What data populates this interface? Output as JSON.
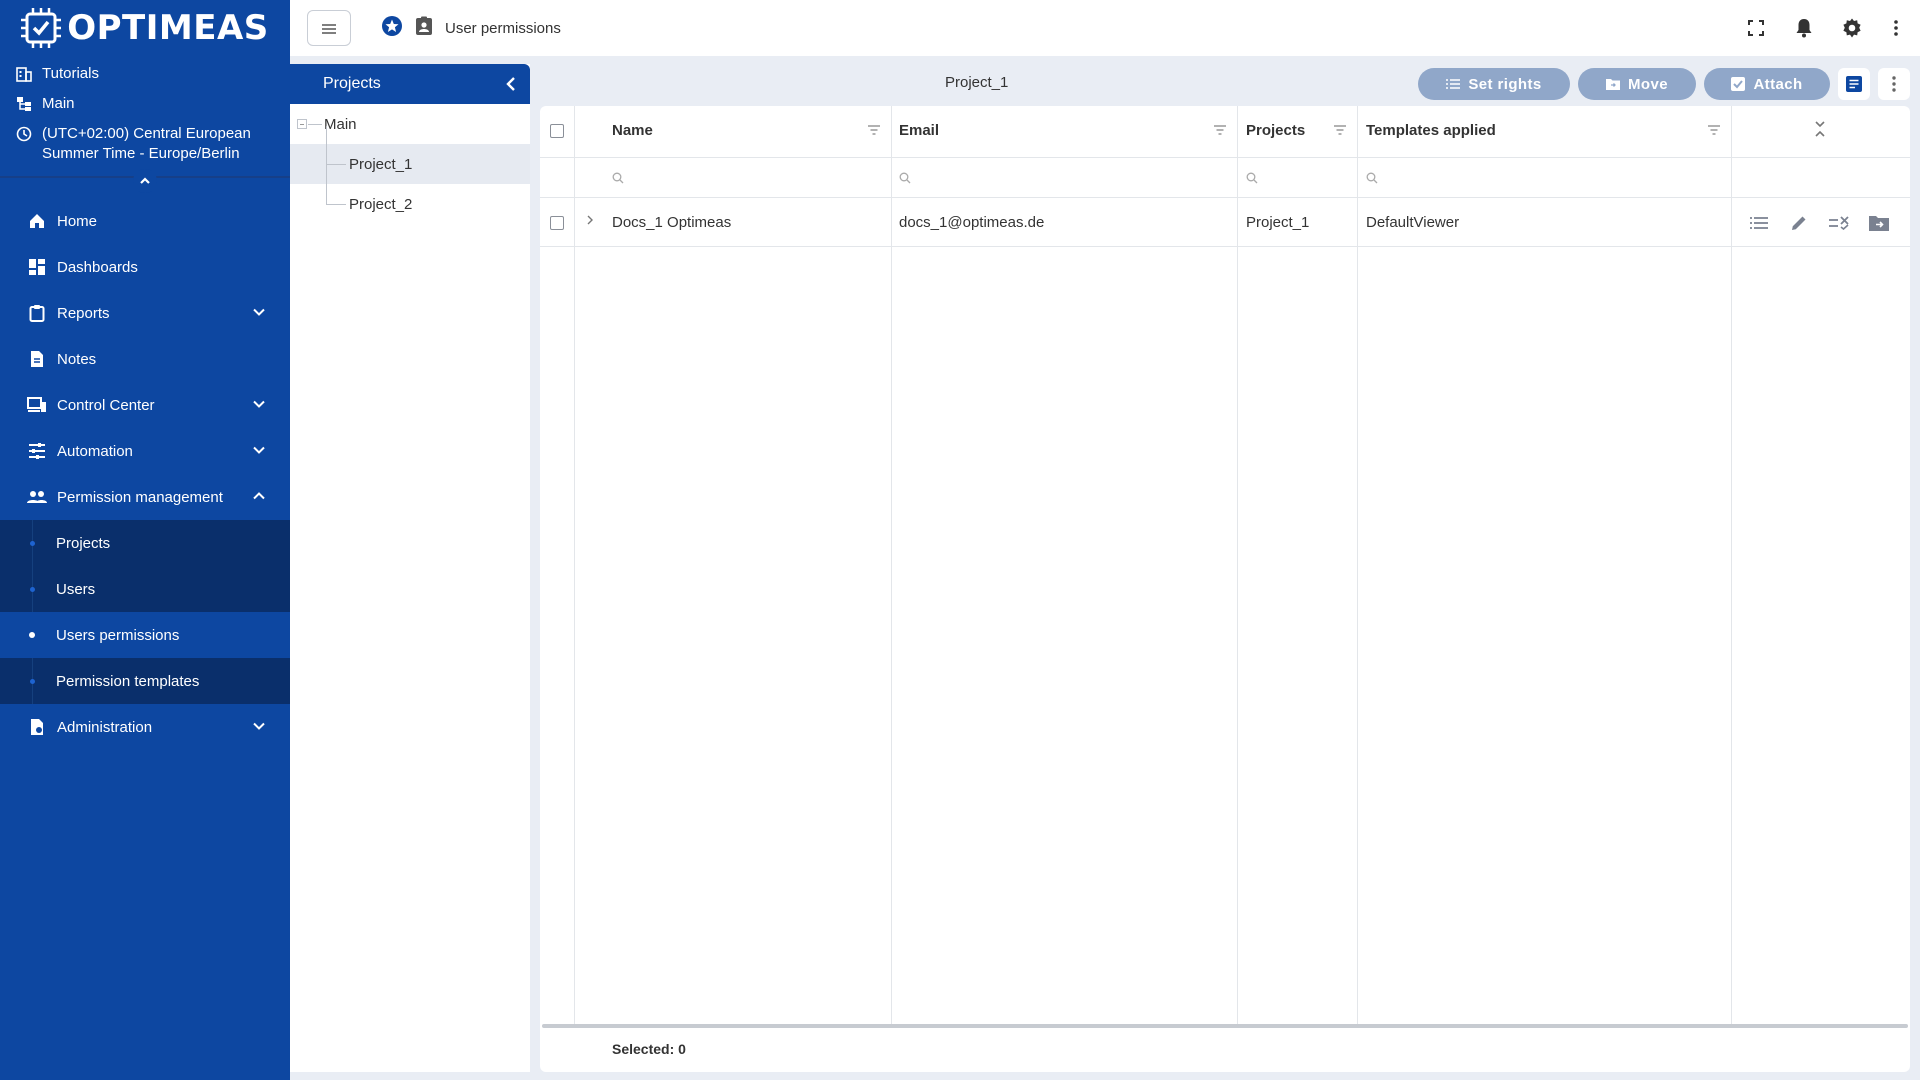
{
  "brand": {
    "name": "OPTIMEAS"
  },
  "sidebar": {
    "meta": {
      "tutorials": "Tutorials",
      "main": "Main",
      "timezone": "(UTC+02:00) Central European Summer Time - Europe/Berlin"
    },
    "items": [
      {
        "label": "Home",
        "icon": "home-icon"
      },
      {
        "label": "Dashboards",
        "icon": "dashboard-icon"
      },
      {
        "label": "Reports",
        "icon": "clipboard-icon",
        "expandable": true
      },
      {
        "label": "Notes",
        "icon": "document-icon"
      },
      {
        "label": "Control Center",
        "icon": "devices-icon",
        "expandable": true
      },
      {
        "label": "Automation",
        "icon": "sliders-icon",
        "expandable": true
      },
      {
        "label": "Permission management",
        "icon": "people-icon",
        "expanded": true
      }
    ],
    "sub_items": [
      {
        "label": "Projects"
      },
      {
        "label": "Users"
      },
      {
        "label": "Users permissions",
        "active": true
      },
      {
        "label": "Permission templates"
      }
    ],
    "after": [
      {
        "label": "Administration",
        "icon": "admin-icon",
        "expandable": true
      }
    ]
  },
  "topbar": {
    "page_title": "User permissions"
  },
  "projects_panel": {
    "title": "Projects",
    "tree": {
      "root": "Main",
      "children": [
        "Project_1",
        "Project_2"
      ],
      "selected": "Project_1"
    }
  },
  "content": {
    "breadcrumb": "Project_1",
    "actions": {
      "set_rights": "Set rights",
      "move": "Move",
      "attach": "Attach"
    },
    "columns": {
      "name": "Name",
      "email": "Email",
      "projects": "Projects",
      "templates": "Templates applied"
    },
    "rows": [
      {
        "name": "Docs_1 Optimeas",
        "email": "docs_1@optimeas.de",
        "projects": "Project_1",
        "templates": "DefaultViewer"
      }
    ],
    "footer": {
      "selected": "Selected: 0"
    }
  },
  "colors": {
    "primary": "#0d47a1",
    "sidebar_sub": "#0a2f6b",
    "action_button": "#90a7c9"
  }
}
